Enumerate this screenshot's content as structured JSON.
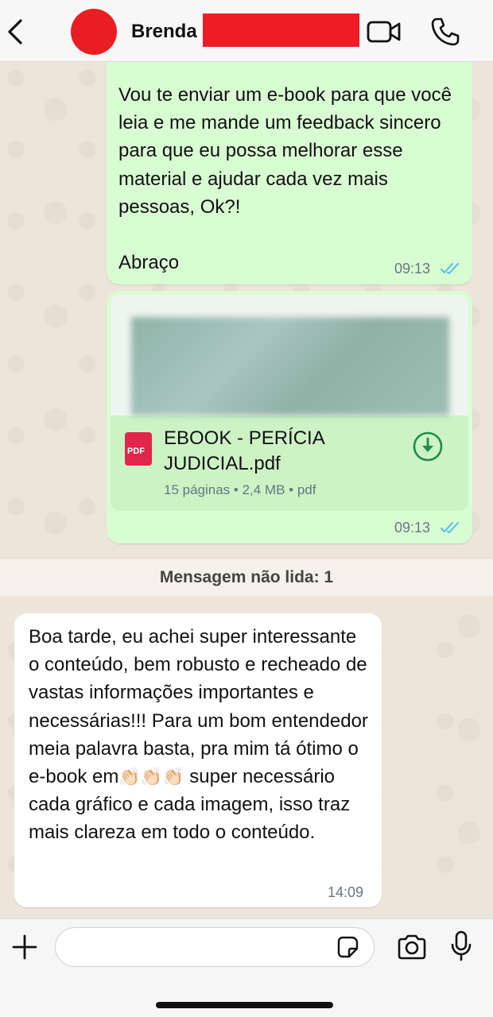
{
  "header": {
    "contact_name": "Brenda",
    "avatar_color": "#ea1c24",
    "redaction_color": "#ee1c25"
  },
  "messages": {
    "outgoing_text": {
      "text": "Vou te enviar um e-book para que você leia e me mande um feedback sincero para que eu possa melhorar esse material e ajudar cada vez mais pessoas, Ok?!\n\nAbraço",
      "time": "09:13",
      "status": "read"
    },
    "outgoing_document": {
      "file_name": "EBOOK - PERÍCIA JUDICIAL.pdf",
      "file_type_badge": "PDF",
      "meta": "15 páginas • 2,4 MB • pdf",
      "time": "09:13",
      "status": "read"
    },
    "unread_divider": "Mensagem não lida: 1",
    "incoming_text": {
      "text_before_emoji": "Boa tarde, eu achei super interessante o conteúdo, bem robusto e recheado de vastas informações importantes e necessárias!!! Para um bom entendedor meia palavra basta, pra mim tá ótimo o e-book em",
      "emoji": "👏🏻👏🏻👏🏻",
      "text_after_emoji": " super necessário cada gráfico e cada imagem, isso traz mais clareza em todo o conteúdo.",
      "time": "14:09"
    }
  },
  "composer": {
    "placeholder": ""
  },
  "colors": {
    "outgoing_bubble": "#d9fdd3",
    "incoming_bubble": "#ffffff",
    "read_ticks": "#53bdeb",
    "accent_green": "#1f8a4c"
  }
}
